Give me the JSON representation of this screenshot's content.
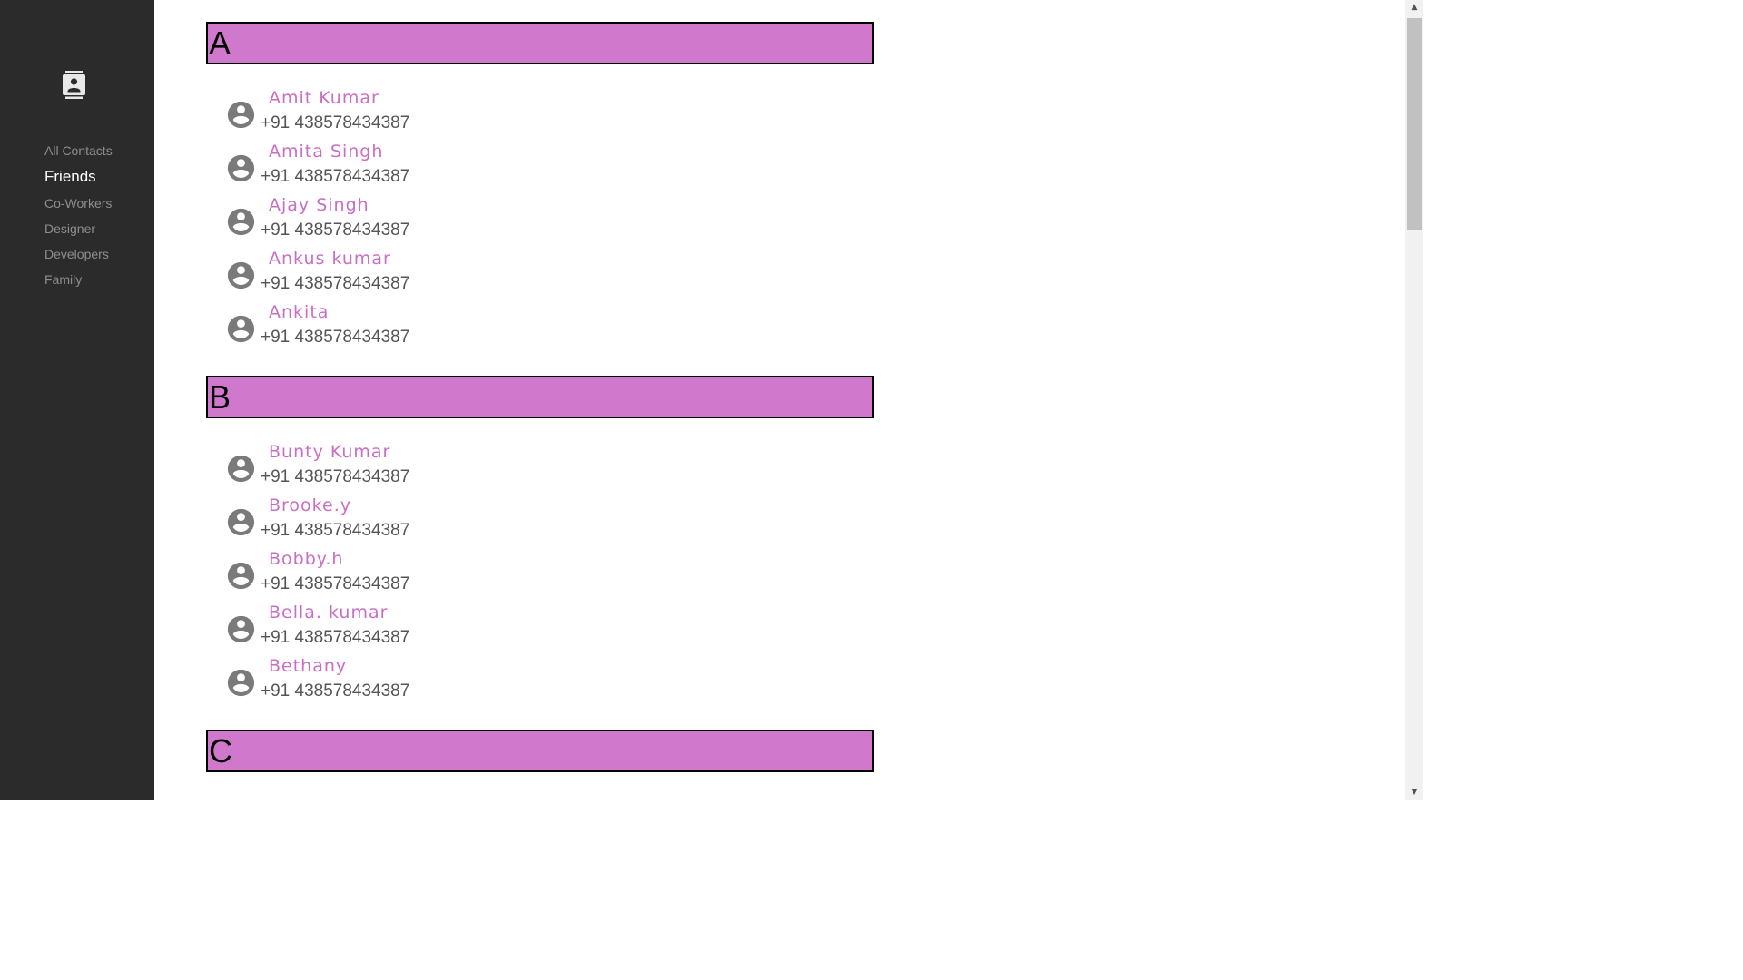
{
  "sidebar": {
    "logo_icon": "contacts-book-icon",
    "items": [
      {
        "label": "All Contacts",
        "active": false
      },
      {
        "label": "Friends",
        "active": true
      },
      {
        "label": "Co-Workers",
        "active": false
      },
      {
        "label": "Designer",
        "active": false
      },
      {
        "label": "Developers",
        "active": false
      },
      {
        "label": "Family",
        "active": false
      }
    ]
  },
  "sections": [
    {
      "letter": "A",
      "contacts": [
        {
          "name": "Amit Kumar",
          "phone": "+91 438578434387"
        },
        {
          "name": "Amita Singh",
          "phone": "+91 438578434387"
        },
        {
          "name": "Ajay Singh",
          "phone": "+91 438578434387"
        },
        {
          "name": "Ankus kumar",
          "phone": "+91 438578434387"
        },
        {
          "name": "Ankita",
          "phone": "+91 438578434387"
        }
      ]
    },
    {
      "letter": "B",
      "contacts": [
        {
          "name": "Bunty Kumar",
          "phone": "+91 438578434387"
        },
        {
          "name": "Brooke.y",
          "phone": "+91 438578434387"
        },
        {
          "name": "Bobby.h",
          "phone": "+91 438578434387"
        },
        {
          "name": "Bella. kumar",
          "phone": "+91 438578434387"
        },
        {
          "name": "Bethany",
          "phone": "+91 438578434387"
        }
      ]
    },
    {
      "letter": "C",
      "contacts": []
    }
  ],
  "colors": {
    "sidebar_bg": "#2b2b2b",
    "section_header_bg": "#d078cb",
    "contact_name": "#c96ec4",
    "contact_phone": "#555555",
    "avatar": "#7a7a7a"
  },
  "icons": {
    "avatar": "account-circle-icon",
    "scroll_up": "scroll-up-arrow-icon",
    "scroll_down": "scroll-down-arrow-icon"
  }
}
